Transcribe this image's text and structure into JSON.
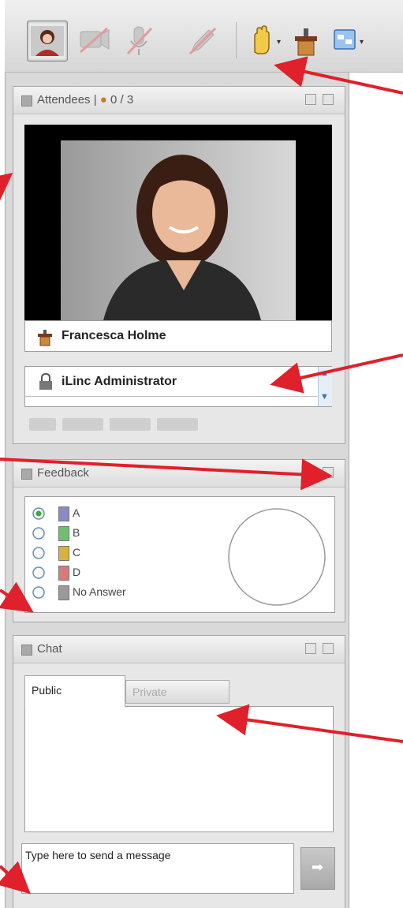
{
  "attendees_panel": {
    "title": "Attendees | ",
    "count": "0 / 3"
  },
  "presenter": {
    "name": "Francesca Holme"
  },
  "attendee_list": {
    "items": [
      "iLinc Administrator"
    ]
  },
  "feedback_panel": {
    "title": "Feedback",
    "options": [
      {
        "label": "A",
        "color": "#8a8ac8",
        "selected": true
      },
      {
        "label": "B",
        "color": "#6fbf6f",
        "selected": false
      },
      {
        "label": "C",
        "color": "#d9b23a",
        "selected": false
      },
      {
        "label": "D",
        "color": "#d97a7a",
        "selected": false
      },
      {
        "label": "No Answer",
        "color": "#9a9a9a",
        "selected": false
      }
    ]
  },
  "chat_panel": {
    "title": "Chat",
    "tabs": [
      {
        "label": "Public",
        "active": true
      },
      {
        "label": "Private",
        "active": false
      }
    ],
    "input_placeholder": "Type here to send a message"
  },
  "colors": {
    "annotation_arrow": "#e0202a",
    "panel_bg": "#e7e7e7"
  },
  "icons": {
    "toolbar": [
      "user-avatar-icon",
      "video-disabled-icon",
      "microphone-disabled-icon",
      "pencil-disabled-icon",
      "raise-hand-icon",
      "podium-icon",
      "layout-icon"
    ],
    "presenter": "podium-icon",
    "attendee": "lock-user-icon",
    "send": "arrow-right-icon"
  }
}
